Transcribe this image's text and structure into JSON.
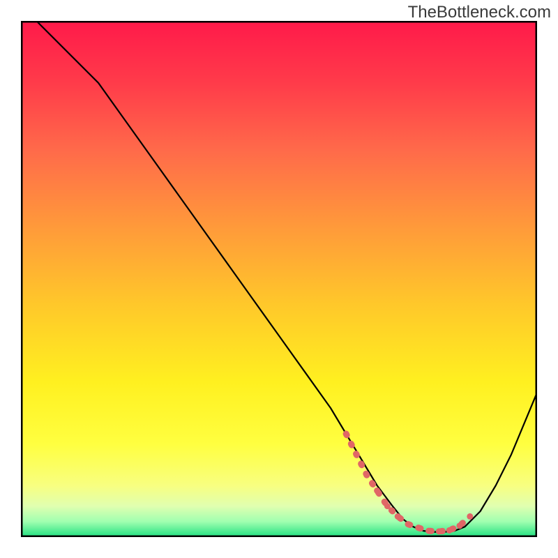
{
  "watermark": "TheBottleneck.com",
  "chart_data": {
    "type": "line",
    "title": "",
    "xlabel": "",
    "ylabel": "",
    "xlim": [
      0,
      100
    ],
    "ylim": [
      0,
      100
    ],
    "series": [
      {
        "name": "curve",
        "x": [
          3,
          6,
          10,
          15,
          20,
          25,
          30,
          35,
          40,
          45,
          50,
          55,
          60,
          63,
          66,
          69,
          72,
          74,
          76,
          78,
          80,
          82,
          84,
          86,
          89,
          92,
          95,
          100
        ],
        "y": [
          100,
          97,
          93,
          88,
          81,
          74,
          67,
          60,
          53,
          46,
          39,
          32,
          25,
          20,
          15,
          10,
          6,
          3.5,
          2,
          1.2,
          1,
          1,
          1.2,
          2,
          5,
          10,
          16,
          28
        ]
      }
    ],
    "trough_markers": {
      "x": [
        63,
        65,
        67,
        69,
        71,
        73,
        75,
        77,
        79,
        81,
        83,
        85,
        87
      ],
      "y": [
        20,
        16,
        12,
        9,
        6,
        4,
        2.5,
        1.8,
        1.2,
        1.1,
        1.3,
        2.2,
        4
      ],
      "color": "#e06666"
    },
    "background_gradient": {
      "stops": [
        {
          "offset": 0.0,
          "color": "#ff1a4a"
        },
        {
          "offset": 0.12,
          "color": "#ff3b4a"
        },
        {
          "offset": 0.25,
          "color": "#ff6a4a"
        },
        {
          "offset": 0.4,
          "color": "#ff9a3a"
        },
        {
          "offset": 0.55,
          "color": "#ffc82a"
        },
        {
          "offset": 0.7,
          "color": "#fff020"
        },
        {
          "offset": 0.82,
          "color": "#ffff40"
        },
        {
          "offset": 0.9,
          "color": "#f8ff80"
        },
        {
          "offset": 0.94,
          "color": "#e0ffb0"
        },
        {
          "offset": 0.97,
          "color": "#a0ffb0"
        },
        {
          "offset": 1.0,
          "color": "#20e080"
        }
      ]
    }
  }
}
